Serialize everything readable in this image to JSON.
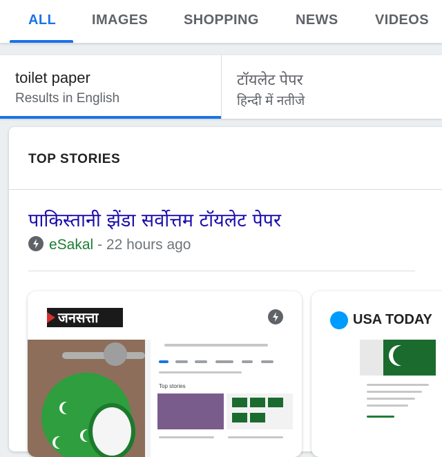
{
  "tabs": {
    "items": [
      "ALL",
      "IMAGES",
      "SHOPPING",
      "NEWS",
      "VIDEOS"
    ],
    "active_index": 0
  },
  "language_toggle": {
    "left": {
      "query": "toilet paper",
      "subtitle": "Results in English"
    },
    "right": {
      "query": "टॉयलेट पेपर",
      "subtitle": "हिन्दी में नतीजे"
    }
  },
  "top_stories": {
    "title": "TOP STORIES",
    "headline": "पाकिस्तानी झेंडा सर्वोत्तम टॉयलेट पेपर",
    "source": "eSakal",
    "separator": " - ",
    "age": "22 hours ago",
    "cards": [
      {
        "publisher": "जनसत्ता",
        "amp_icon": "amp-lightning-icon"
      },
      {
        "publisher": "USA TODAY"
      }
    ]
  },
  "colors": {
    "accent": "#1a73e8",
    "link": "#1a0dab",
    "source_green": "#1e7b34",
    "usa_blue": "#009bff"
  }
}
